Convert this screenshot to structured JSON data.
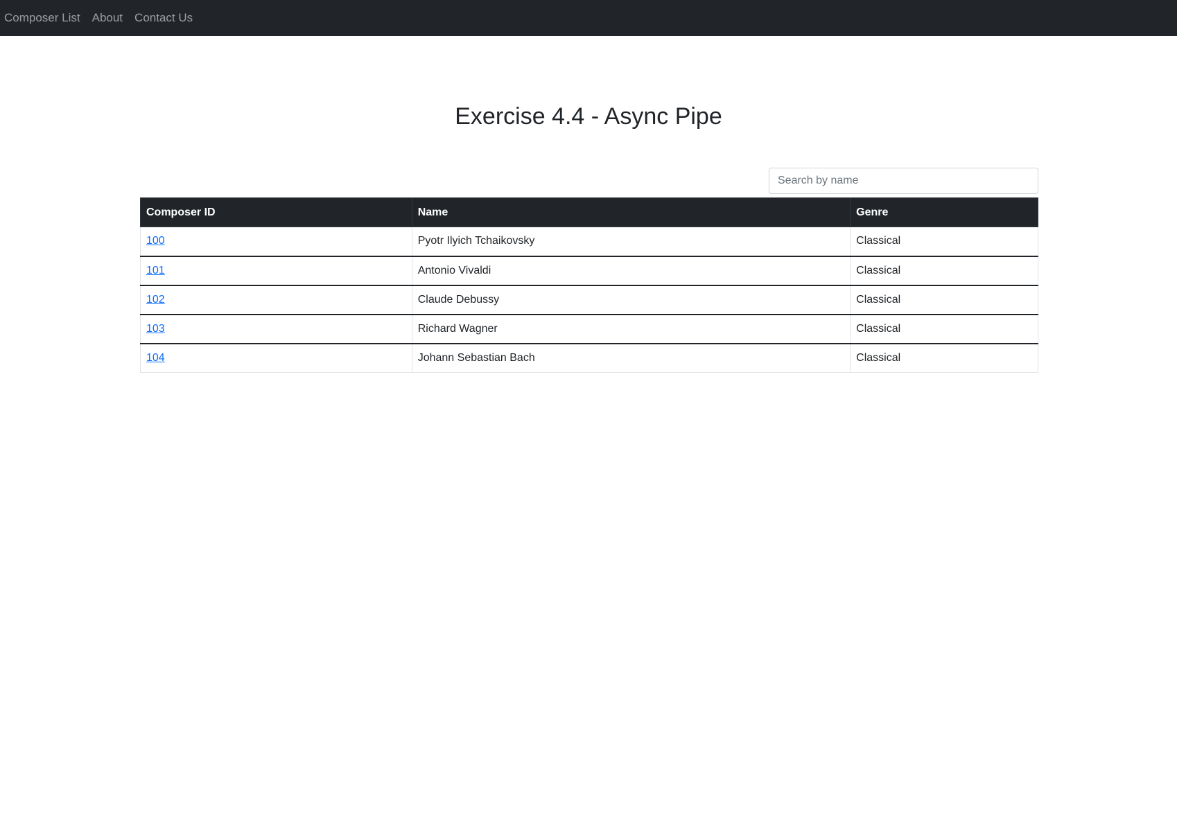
{
  "nav": {
    "items": [
      {
        "label": "Composer List"
      },
      {
        "label": "About"
      },
      {
        "label": "Contact Us"
      }
    ]
  },
  "page": {
    "title": "Exercise 4.4 - Async Pipe"
  },
  "search": {
    "placeholder": "Search by name",
    "value": ""
  },
  "table": {
    "headers": [
      "Composer ID",
      "Name",
      "Genre"
    ],
    "rows": [
      {
        "id": "100",
        "name": "Pyotr Ilyich Tchaikovsky",
        "genre": "Classical"
      },
      {
        "id": "101",
        "name": "Antonio Vivaldi",
        "genre": "Classical"
      },
      {
        "id": "102",
        "name": "Claude Debussy",
        "genre": "Classical"
      },
      {
        "id": "103",
        "name": "Richard Wagner",
        "genre": "Classical"
      },
      {
        "id": "104",
        "name": "Johann Sebastian Bach",
        "genre": "Classical"
      }
    ]
  },
  "colors": {
    "navbar_bg": "#212529",
    "link": "#0d6efd",
    "table_header_bg": "#212529"
  }
}
